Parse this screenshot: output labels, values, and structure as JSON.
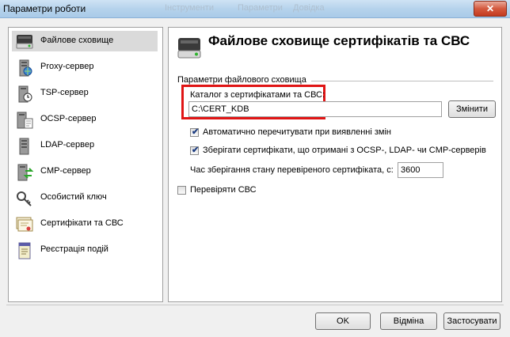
{
  "window": {
    "title": "Параметри роботи",
    "bg_menu": [
      "Інструменти",
      "Параметри",
      "Довідка"
    ]
  },
  "sidebar": {
    "items": [
      {
        "label": "Файлове сховище",
        "icon": "drive-icon"
      },
      {
        "label": "Proxy-сервер",
        "icon": "proxy-server-icon"
      },
      {
        "label": "TSP-сервер",
        "icon": "tsp-server-icon"
      },
      {
        "label": "OCSP-сервер",
        "icon": "ocsp-server-icon"
      },
      {
        "label": "LDAP-сервер",
        "icon": "ldap-server-icon"
      },
      {
        "label": "CMP-сервер",
        "icon": "cmp-server-icon"
      },
      {
        "label": "Особистий ключ",
        "icon": "key-icon"
      },
      {
        "label": "Сертифікати та СВС",
        "icon": "certificates-icon"
      },
      {
        "label": "Реєстрація подій",
        "icon": "event-log-icon"
      }
    ],
    "selected_index": 0
  },
  "panel": {
    "title": "Файлове сховище сертифікатів та СВС",
    "group_label": "Параметри файлового сховища",
    "catalog_label": "Каталог з сертифікатами та СВС:",
    "catalog_path": "C:\\CERT_KDB",
    "change_button": "Змінити",
    "auto_reread": {
      "label": "Автоматично перечитувати при виявленні змін",
      "checked": true
    },
    "save_certs": {
      "label": "Зберігати сертифікати, що отримані з OCSP-, LDAP- чи CMP-серверів",
      "checked": true
    },
    "cache_time_label": "Час зберігання стану перевіреного сертифіката, с:",
    "cache_time_value": "3600",
    "check_crl": {
      "label": "Перевіряти СВС",
      "checked": false
    }
  },
  "footer": {
    "ok": "OK",
    "cancel": "Відміна",
    "apply": "Застосувати"
  },
  "colors": {
    "highlight": "#e01515",
    "selected_bg": "#dadada"
  }
}
